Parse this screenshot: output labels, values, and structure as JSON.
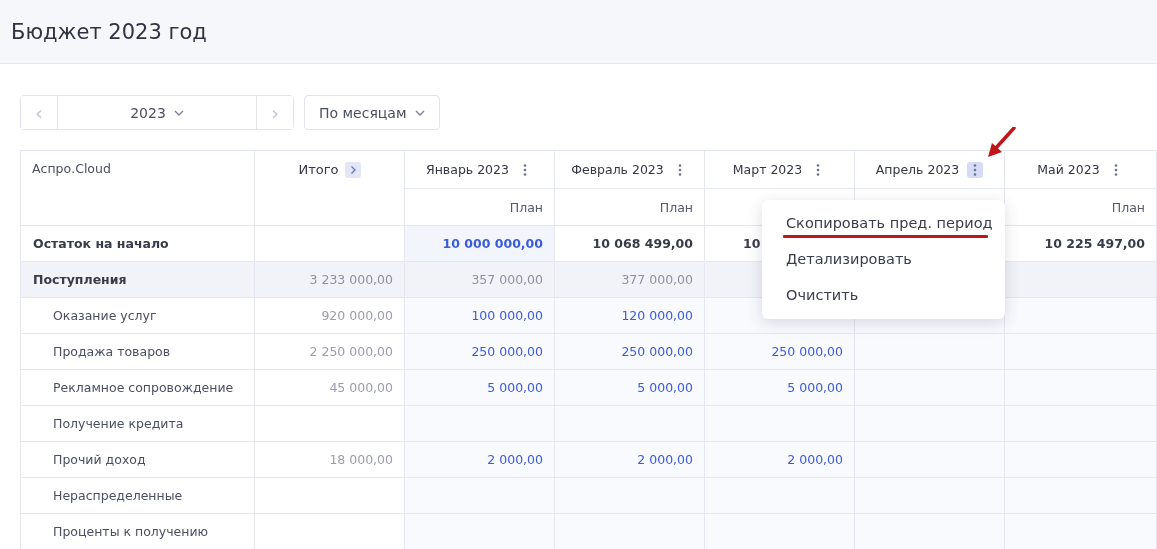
{
  "page_title": "Бюджет 2023 год",
  "toolbar": {
    "prev_symbol": "‹",
    "year": "2023",
    "next_symbol": "›",
    "grouping": "По месяцам"
  },
  "table": {
    "corner": "Аспро.Cloud",
    "total_header": "Итого",
    "months": [
      {
        "label": "Январь 2023",
        "menu_open": false,
        "sub": "План"
      },
      {
        "label": "Февраль 2023",
        "menu_open": false,
        "sub": "План"
      },
      {
        "label": "Март 2023",
        "menu_open": false
      },
      {
        "label": "Апрель 2023",
        "menu_open": true
      },
      {
        "label": "Май 2023",
        "menu_open": false,
        "sub": "План"
      }
    ],
    "rows": [
      {
        "label": "Остаток на начало",
        "kind": "balance",
        "cells": [
          {
            "text": "10 000 000,00",
            "editable": true
          },
          {
            "text": "10 068 499,00",
            "editable": false
          },
          {
            "text": "10",
            "covered": true
          },
          null,
          {
            "text": "10 225 497,00",
            "editable": false
          }
        ]
      },
      {
        "label": "Поступления",
        "kind": "group",
        "total": "3 233 000,00",
        "cells": [
          {
            "text": "357 000,00"
          },
          {
            "text": "377 000,00"
          },
          {},
          null,
          {}
        ]
      },
      {
        "label": "Оказание услуг",
        "kind": "item",
        "total": "920 000,00",
        "cells": [
          {
            "text": "100 000,00"
          },
          {
            "text": "120 000,00"
          },
          {},
          {},
          {}
        ]
      },
      {
        "label": "Продажа товаров",
        "kind": "item",
        "total": "2 250 000,00",
        "cells": [
          {
            "text": "250 000,00"
          },
          {
            "text": "250 000,00"
          },
          {
            "text": "250 000,00"
          },
          {},
          {}
        ]
      },
      {
        "label": "Рекламное сопровождение",
        "kind": "item",
        "total": "45 000,00",
        "cells": [
          {
            "text": "5 000,00"
          },
          {
            "text": "5 000,00"
          },
          {
            "text": "5 000,00"
          },
          {},
          {}
        ]
      },
      {
        "label": "Получение кредита",
        "kind": "item",
        "cells": [
          {},
          {},
          {},
          {},
          {}
        ]
      },
      {
        "label": "Прочий доход",
        "kind": "item",
        "total": "18 000,00",
        "cells": [
          {
            "text": "2 000,00"
          },
          {
            "text": "2 000,00"
          },
          {
            "text": "2 000,00"
          },
          {},
          {}
        ]
      },
      {
        "label": "Нераспределенные",
        "kind": "item",
        "cells": [
          {},
          {},
          {},
          {},
          {}
        ]
      },
      {
        "label": "Проценты к получению",
        "kind": "item",
        "cells": [
          {},
          {},
          {},
          {},
          {}
        ]
      }
    ]
  },
  "context_menu": {
    "items": [
      {
        "label": "Скопировать пред. период",
        "annotated": true
      },
      {
        "label": "Детализировать",
        "annotated": false
      },
      {
        "label": "Очистить",
        "annotated": false
      }
    ]
  }
}
